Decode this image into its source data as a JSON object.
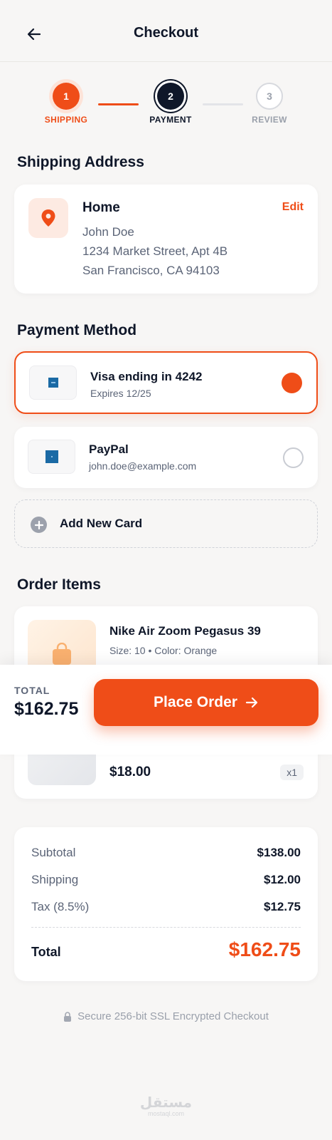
{
  "header": {
    "title": "Checkout"
  },
  "stepper": {
    "steps": [
      {
        "number": "1",
        "label": "SHIPPING"
      },
      {
        "number": "2",
        "label": "PAYMENT"
      },
      {
        "number": "3",
        "label": "REVIEW"
      }
    ]
  },
  "shipping": {
    "section_title": "Shipping Address",
    "name": "Home",
    "edit_label": "Edit",
    "recipient": "John Doe",
    "street": "1234 Market Street, Apt 4B",
    "city": "San Francisco, CA 94103"
  },
  "payment": {
    "section_title": "Payment Method",
    "methods": [
      {
        "name": "Visa ending in 4242",
        "detail": "Expires 12/25",
        "selected": true
      },
      {
        "name": "PayPal",
        "detail": "john.doe@example.com",
        "selected": false
      }
    ],
    "add_label": "Add New Card"
  },
  "order": {
    "section_title": "Order Items",
    "items": [
      {
        "name": "Nike Air Zoom Pegasus 39",
        "meta": "Size: 10 • Color: Orange"
      },
      {
        "price": "$18.00",
        "qty": "x1"
      }
    ]
  },
  "sticky": {
    "total_label": "TOTAL",
    "total_value": "$162.75",
    "cta_label": "Place Order"
  },
  "summary": {
    "rows": [
      {
        "label": "Subtotal",
        "value": "$138.00"
      },
      {
        "label": "Shipping",
        "value": "$12.00"
      },
      {
        "label": "Tax (8.5%)",
        "value": "$12.75"
      }
    ],
    "total_label": "Total",
    "total_value": "$162.75"
  },
  "footer": {
    "secure_text": "Secure 256-bit SSL Encrypted Checkout",
    "watermark_text": "مستقل",
    "watermark_sub": "mostaql.com"
  },
  "colors": {
    "accent": "#ef4d18",
    "dark": "#0f1729",
    "muted": "#5b6477",
    "background": "#f7f6f5"
  },
  "icons": [
    "arrow-left-icon",
    "location-pin-icon",
    "card-logo-icon",
    "plus-icon",
    "shopping-bag-icon",
    "arrow-right-icon",
    "lock-icon"
  ]
}
